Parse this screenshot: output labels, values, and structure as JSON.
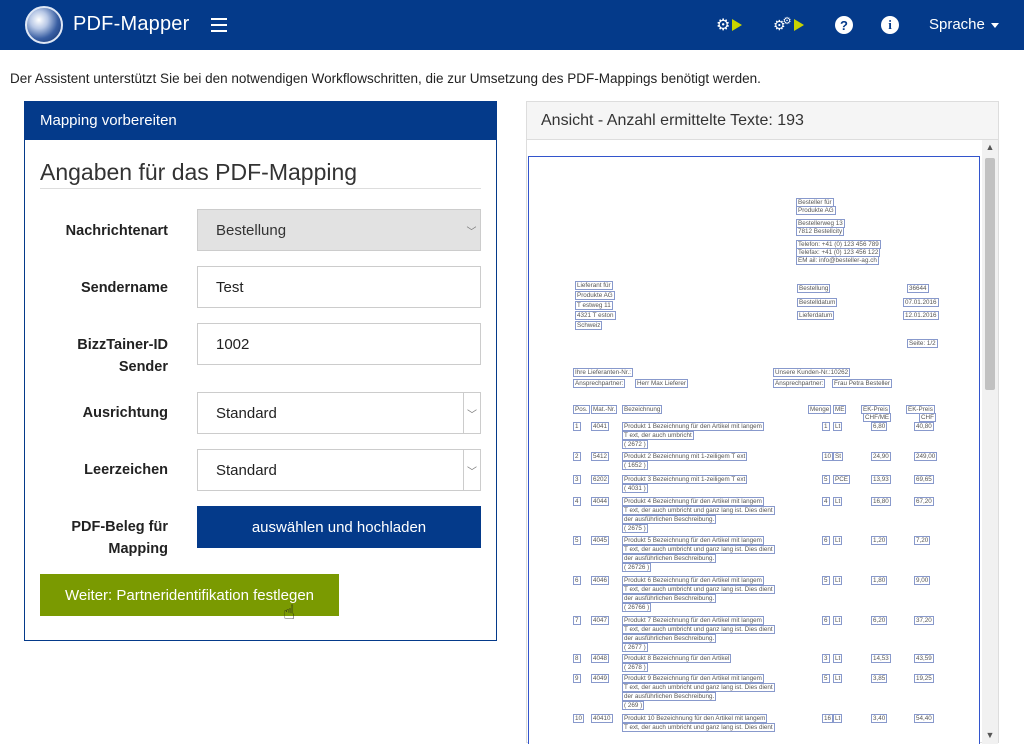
{
  "header": {
    "app_title": "PDF-Mapper",
    "language_label": "Sprache",
    "icons": [
      "gear-play-icon",
      "gears-play-icon",
      "help-icon",
      "info-icon"
    ]
  },
  "intro_text": "Der Assistent unterstützt Sie bei den notwendigen Workflowschritten, die zur Umsetzung des PDF-Mappings benötigt werden.",
  "left_panel": {
    "header": "Mapping vorbereiten",
    "section_title": "Angaben für das PDF-Mapping",
    "fields": {
      "message_type": {
        "label": "Nachrichtenart",
        "value": "Bestellung"
      },
      "sender_name": {
        "label": "Sendername",
        "value": "Test"
      },
      "bizztainer_id": {
        "label": "BizzTainer-ID Sender",
        "value": "1002"
      },
      "alignment": {
        "label": "Ausrichtung",
        "value": "Standard"
      },
      "spaces": {
        "label": "Leerzeichen",
        "value": "Standard"
      },
      "pdf_upload": {
        "label": "PDF-Beleg für Mapping",
        "button": "auswählen und hochladen"
      }
    },
    "next_button": "Weiter: Partneridentifikation festlegen"
  },
  "right_panel": {
    "header": "Ansicht - Anzahl ermittelte Texte: 193",
    "pdf_texts": {
      "b1": "Besteller für",
      "b2": "Produkte AG",
      "b3": "Bestellerweg 13",
      "b4": "7812 Bestellcity",
      "b5": "Telefon: +41 (0) 123 456 789",
      "b6": "Telefax: +41 (0) 123 456 122",
      "b7": "EM ail: info@besteller-ag.ch",
      "l1": "Lieferant für",
      "l2": "Produkte AG",
      "l3": "T estweg 11",
      "l4": "4321 T eston",
      "l5": "Schweiz",
      "o1": "Bestellung",
      "o2": "36644",
      "o3": "Bestelldatum",
      "o4": "07.01.2016",
      "o5": "Lieferdatum",
      "o6": "12.01.2016",
      "o7": "Seite: 1/2",
      "r1": "Ihre Lieferanten-Nr.:",
      "r2": "Ansprechpartner:",
      "r3": "Herr Max Lieferer",
      "r4": "Unsere Kunden-Nr.:10262",
      "r5": "Ansprechpartner:",
      "r6": "Frau Petra Besteller",
      "h1": "Pos.",
      "h2": "Mat.-Nr.",
      "h3": "Bezeichnung",
      "h4": "Menge",
      "h5": "ME",
      "h6": "EK-Preis",
      "h7": "CHF/ME",
      "h8": "EK-Preis",
      "h9": "CHF"
    },
    "rows": [
      {
        "pos": "1",
        "mat": "4041",
        "desc": [
          "Produkt 1 Bezeichnung für den Artikel mit langem",
          "T ext, der auch umbricht",
          "( 2672 )"
        ],
        "qty": "1",
        "me": "Lt",
        "price": "6,80",
        "total": "40,80"
      },
      {
        "pos": "2",
        "mat": "5412",
        "desc": [
          "Produkt 2 Bezeichnung mit 1-zeiligem T ext",
          "( 1652 )"
        ],
        "qty": "10",
        "me": "St",
        "price": "24,90",
        "total": "249,00"
      },
      {
        "pos": "3",
        "mat": "6202",
        "desc": [
          "Produkt 3 Bezeichnung mit 1-zeiligem T ext",
          "( 4031 )"
        ],
        "qty": "5",
        "me": "PCE",
        "price": "13,93",
        "total": "69,65"
      },
      {
        "pos": "4",
        "mat": "4044",
        "desc": [
          "Produkt 4 Bezeichnung für den Artikel mit langem",
          "T ext, der auch umbricht und ganz lang ist. Dies dient",
          "der ausführlichen Beschreibung.",
          "( 2675 )"
        ],
        "qty": "4",
        "me": "Lt",
        "price": "16,80",
        "total": "67,20"
      },
      {
        "pos": "5",
        "mat": "4045",
        "desc": [
          "Produkt 5 Bezeichnung für den Artikel mit langem",
          "T ext, der auch umbricht und ganz lang ist. Dies dient",
          "der ausführlichen Beschreibung.",
          "( 26726 )"
        ],
        "qty": "6",
        "me": "Lt",
        "price": "1,20",
        "total": "7,20"
      },
      {
        "pos": "6",
        "mat": "4046",
        "desc": [
          "Produkt 6 Bezeichnung für den Artikel mit langem",
          "T ext, der auch umbricht und ganz lang ist. Dies dient",
          "der ausführlichen Beschreibung.",
          "( 26766 )"
        ],
        "qty": "5",
        "me": "Lt",
        "price": "1,80",
        "total": "9,00"
      },
      {
        "pos": "7",
        "mat": "4047",
        "desc": [
          "Produkt 7 Bezeichnung für den Artikel mit langem",
          "T ext, der auch umbricht und ganz lang ist. Dies dient",
          "der ausführlichen Beschreibung.",
          "( 2677 )"
        ],
        "qty": "6",
        "me": "Lt",
        "price": "6,20",
        "total": "37,20"
      },
      {
        "pos": "8",
        "mat": "4048",
        "desc": [
          "Produkt 8 Bezeichnung für den Artikel",
          "( 2678 )"
        ],
        "qty": "3",
        "me": "Lt",
        "price": "14,53",
        "total": "43,59"
      },
      {
        "pos": "9",
        "mat": "4049",
        "desc": [
          "Produkt 9 Bezeichnung für den Artikel mit langem",
          "T ext, der auch umbricht und ganz lang ist. Dies dient",
          "der ausführlichen Beschreibung.",
          "( 269 )"
        ],
        "qty": "5",
        "me": "Lt",
        "price": "3,85",
        "total": "19,25"
      },
      {
        "pos": "10",
        "mat": "40410",
        "desc": [
          "Produkt 10 Bezeichnung für den Artikel mit langem",
          "T ext, der auch umbricht und ganz lang ist. Dies dient"
        ],
        "qty": "16",
        "me": "Lt",
        "price": "3,40",
        "total": "54,40"
      }
    ]
  }
}
